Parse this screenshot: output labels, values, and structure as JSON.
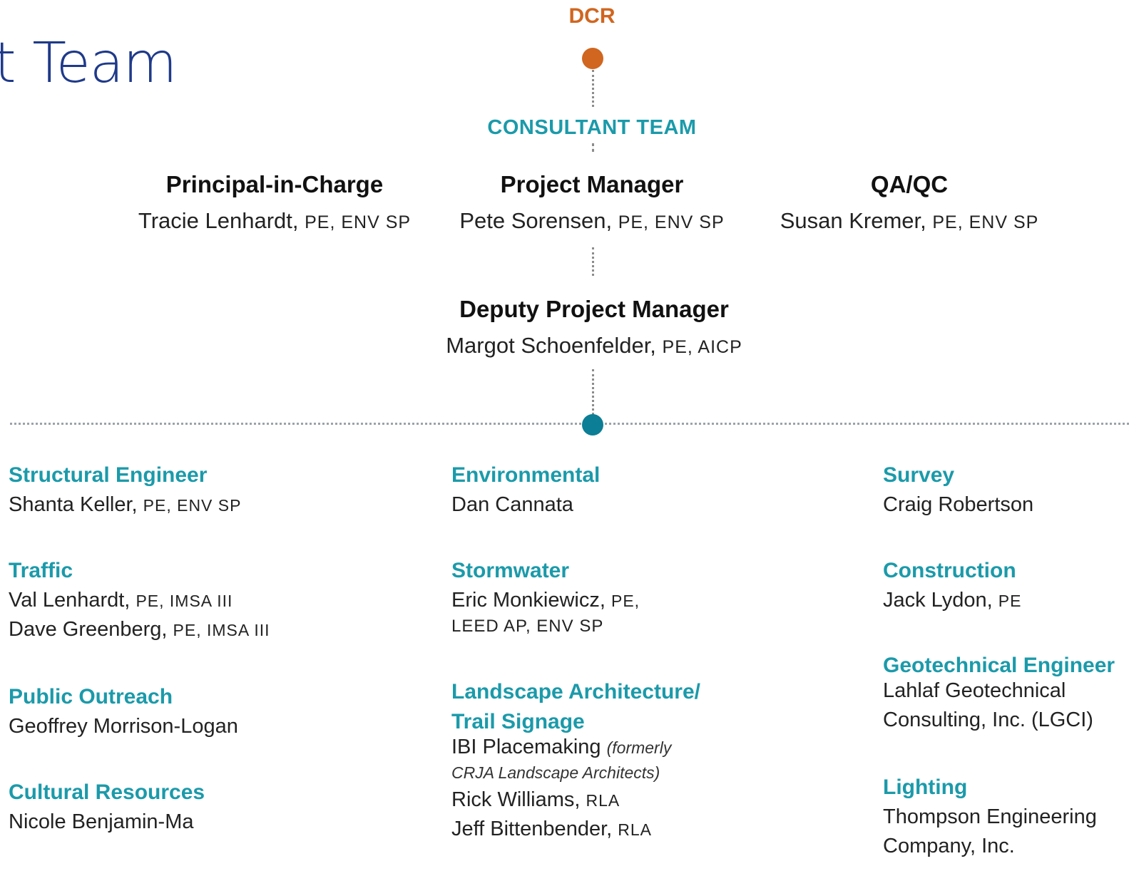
{
  "page": {
    "title": "t Team"
  },
  "top": {
    "dcr": "DCR",
    "consultant_team": "CONSULTANT TEAM"
  },
  "leads": {
    "principal": {
      "role": "Principal-in-Charge",
      "name": "Tracie Lenhardt,",
      "cred": "PE, ENV SP"
    },
    "pm": {
      "role": "Project Manager",
      "name": "Pete Sorensen,",
      "cred": "PE, ENV SP"
    },
    "qaqc": {
      "role": "QA/QC",
      "name": "Susan Kremer,",
      "cred": "PE, ENV SP"
    },
    "deputy": {
      "role": "Deputy Project Manager",
      "name": "Margot Schoenfelder,",
      "cred": "PE, AICP"
    }
  },
  "disciplines": {
    "structural": {
      "title": "Structural Engineer",
      "name": "Shanta Keller,",
      "cred": "PE, ENV SP"
    },
    "traffic": {
      "title": "Traffic",
      "p1_name": "Val Lenhardt,",
      "p1_cred": "PE, IMSA III",
      "p2_name": "Dave Greenberg,",
      "p2_cred": "PE, IMSA III"
    },
    "outreach": {
      "title": "Public Outreach",
      "name": "Geoffrey Morrison-Logan"
    },
    "cultural": {
      "title": "Cultural Resources",
      "name": "Nicole Benjamin-Ma"
    },
    "environmental": {
      "title": "Environmental",
      "name": "Dan Cannata"
    },
    "stormwater": {
      "title": "Stormwater",
      "name": "Eric Monkiewicz,",
      "cred1": "PE,",
      "cred2": "LEED AP, ENV SP"
    },
    "landscape": {
      "title1": "Landscape Architecture/",
      "title2": "Trail Signage",
      "firm": "IBI Placemaking",
      "note1": "(formerly",
      "note2": "CRJA Landscape Architects)",
      "p1_name": "Rick Williams,",
      "p1_cred": "RLA",
      "p2_name": "Jeff Bittenbender,",
      "p2_cred": "RLA"
    },
    "survey": {
      "title": "Survey",
      "name": "Craig Robertson"
    },
    "construction": {
      "title": "Construction",
      "name": "Jack Lydon,",
      "cred": "PE"
    },
    "geotech": {
      "title": "Geotechnical Engineer",
      "line1": "Lahlaf Geotechnical",
      "line2": "Consulting, Inc. (LGCI)"
    },
    "lighting": {
      "title": "Lighting",
      "line1": "Thompson Engineering",
      "line2": "Company, Inc."
    }
  },
  "colors": {
    "orange": "#d0661f",
    "teal": "#1b9aaa",
    "dark_teal": "#0c7e95",
    "title_blue": "#1f3a8a"
  }
}
